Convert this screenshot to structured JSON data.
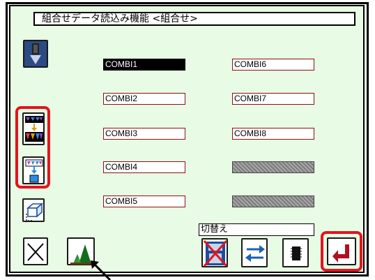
{
  "title": "組合せデータ読込み機能 <組合せ>",
  "slots_left": [
    "COMBI1",
    "COMBI2",
    "COMBI3",
    "COMBI4",
    "COMBI5"
  ],
  "slots_right": [
    "COMBI6",
    "COMBI7",
    "COMBI8",
    "",
    ""
  ],
  "selected_slot": "COMBI1",
  "switch_label": "切替え",
  "icons": {
    "top_left": "load-arrow-icon",
    "group_combo": "combination-sets-icon",
    "single_combo": "combination-single-icon",
    "cube": "cube-outline-icon",
    "cancel": "close-x-icon",
    "trees": "trees-icon",
    "pc_prohibited": "pc-disabled-icon",
    "exchange": "exchange-arrows-icon",
    "chip": "memory-chip-icon",
    "enter": "enter-return-icon"
  },
  "colors": {
    "background": "#e8fbe4",
    "highlight": "#e2141e",
    "slot_border": "#8c1010"
  }
}
